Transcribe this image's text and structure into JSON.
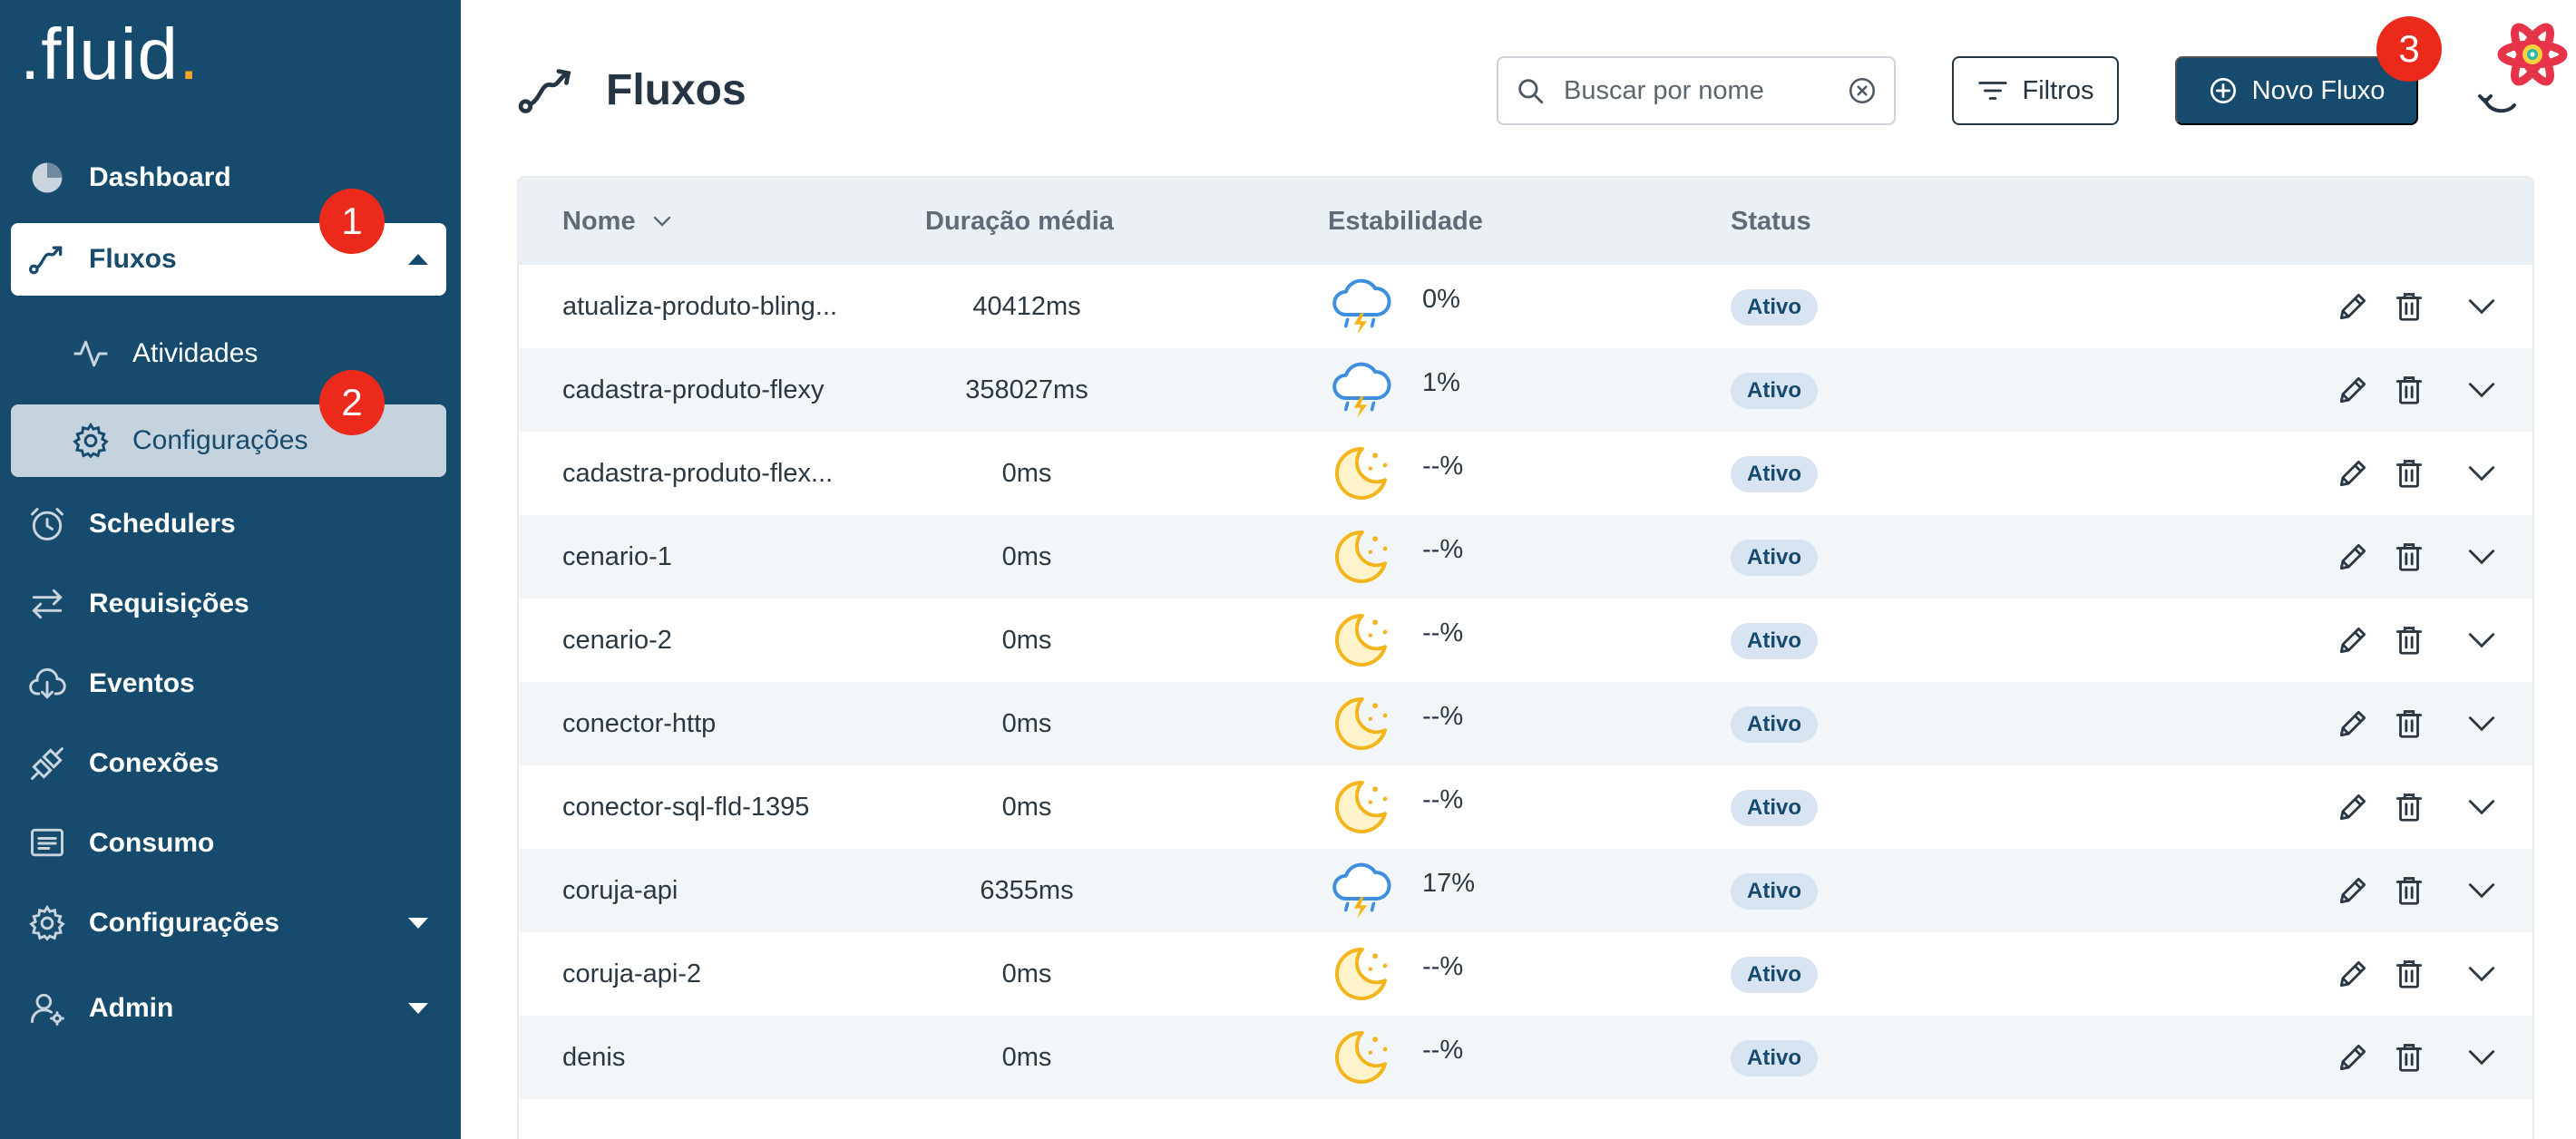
{
  "sidebar": {
    "logo": ".fluid",
    "logo_dot": ".",
    "items": [
      {
        "label": "Dashboard",
        "icon": "pie-chart-icon"
      },
      {
        "label": "Fluxos",
        "icon": "flow-icon"
      },
      {
        "label": "Atividades",
        "icon": "activity-icon"
      },
      {
        "label": "Configurações",
        "icon": "gear-icon"
      },
      {
        "label": "Schedulers",
        "icon": "alarm-clock-icon"
      },
      {
        "label": "Requisições",
        "icon": "swap-arrows-icon"
      },
      {
        "label": "Eventos",
        "icon": "cloud-download-icon"
      },
      {
        "label": "Conexões",
        "icon": "plug-icon"
      },
      {
        "label": "Consumo",
        "icon": "message-box-icon"
      },
      {
        "label": "Configurações",
        "icon": "gear-icon"
      },
      {
        "label": "Admin",
        "icon": "user-gear-icon"
      }
    ]
  },
  "badges": [
    "1",
    "2",
    "3"
  ],
  "header": {
    "title": "Fluxos",
    "search_placeholder": "Buscar por nome",
    "filter_label": "Filtros",
    "new_label": "Novo Fluxo"
  },
  "table": {
    "columns": [
      "Nome",
      "Duração média",
      "Estabilidade",
      "Status"
    ],
    "rows": [
      {
        "name": "atualiza-produto-bling...",
        "duration": "40412ms",
        "stability": "0%",
        "weather": "storm",
        "status": "Ativo"
      },
      {
        "name": "cadastra-produto-flexy",
        "duration": "358027ms",
        "stability": "1%",
        "weather": "storm",
        "status": "Ativo"
      },
      {
        "name": "cadastra-produto-flex...",
        "duration": "0ms",
        "stability": "--%",
        "weather": "moon",
        "status": "Ativo"
      },
      {
        "name": "cenario-1",
        "duration": "0ms",
        "stability": "--%",
        "weather": "moon",
        "status": "Ativo"
      },
      {
        "name": "cenario-2",
        "duration": "0ms",
        "stability": "--%",
        "weather": "moon",
        "status": "Ativo"
      },
      {
        "name": "conector-http",
        "duration": "0ms",
        "stability": "--%",
        "weather": "moon",
        "status": "Ativo"
      },
      {
        "name": "conector-sql-fld-1395",
        "duration": "0ms",
        "stability": "--%",
        "weather": "moon",
        "status": "Ativo"
      },
      {
        "name": "coruja-api",
        "duration": "6355ms",
        "stability": "17%",
        "weather": "storm",
        "status": "Ativo"
      },
      {
        "name": "coruja-api-2",
        "duration": "0ms",
        "stability": "--%",
        "weather": "moon",
        "status": "Ativo"
      },
      {
        "name": "denis",
        "duration": "0ms",
        "stability": "--%",
        "weather": "moon",
        "status": "Ativo"
      }
    ]
  },
  "colors": {
    "sidebar": "#174b6d",
    "accent": "#174b6d",
    "badge": "#ec2a1c",
    "status_bg": "#d8e4f2",
    "logo_dot": "#f4a524"
  }
}
